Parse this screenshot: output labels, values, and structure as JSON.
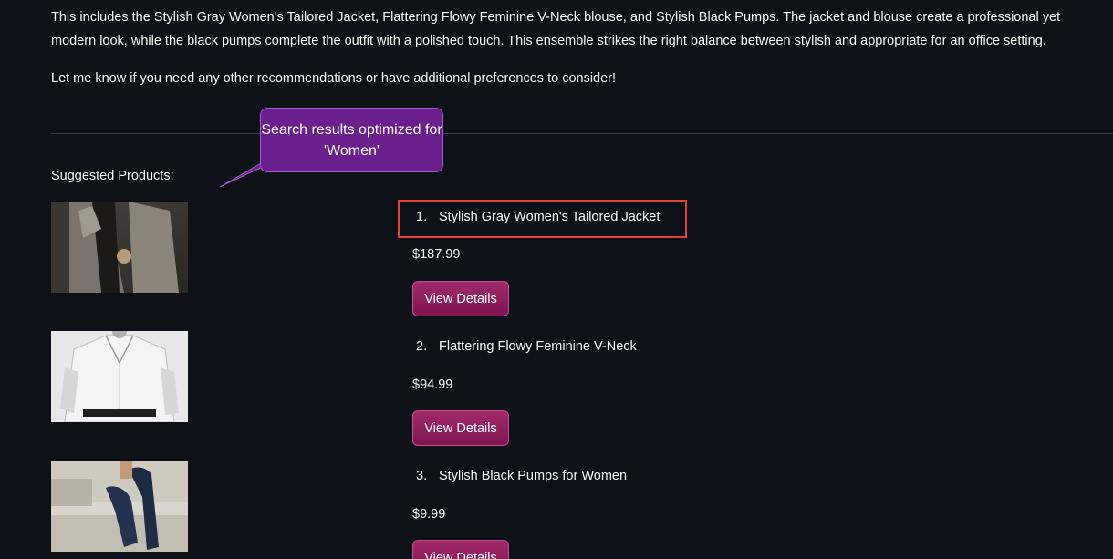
{
  "message": {
    "paragraph_1": "This includes the Stylish Gray Women's Tailored Jacket, Flattering Flowy Feminine V-Neck blouse, and Stylish Black Pumps. The jacket and blouse create a professional yet modern look, while the black pumps complete the outfit with a polished touch. This ensemble strikes the right balance between stylish and appropriate for an office setting.",
    "paragraph_2": "Let me know if you need any other recommendations or have additional preferences to consider!"
  },
  "callout": {
    "text": "Search results optimized for 'Women'"
  },
  "suggested": {
    "heading": "Suggested Products:",
    "button_label": "View Details",
    "products": [
      {
        "number": "1.",
        "name": "Stylish Gray Women's Tailored Jacket",
        "price": "$187.99",
        "image": "gray-tailored-jacket-photo"
      },
      {
        "number": "2.",
        "name": "Flattering Flowy Feminine V-Neck",
        "price": "$94.99",
        "image": "white-v-neck-blouse-photo"
      },
      {
        "number": "3.",
        "name": "Stylish Black Pumps for Women",
        "price": "$9.99",
        "image": "navy-pumps-photo"
      }
    ]
  },
  "colors": {
    "background": "#0e1117",
    "text": "#fafafa",
    "button": "#8e1d5e",
    "callout": "#6a1f8c",
    "highlight": "#e0443a"
  }
}
